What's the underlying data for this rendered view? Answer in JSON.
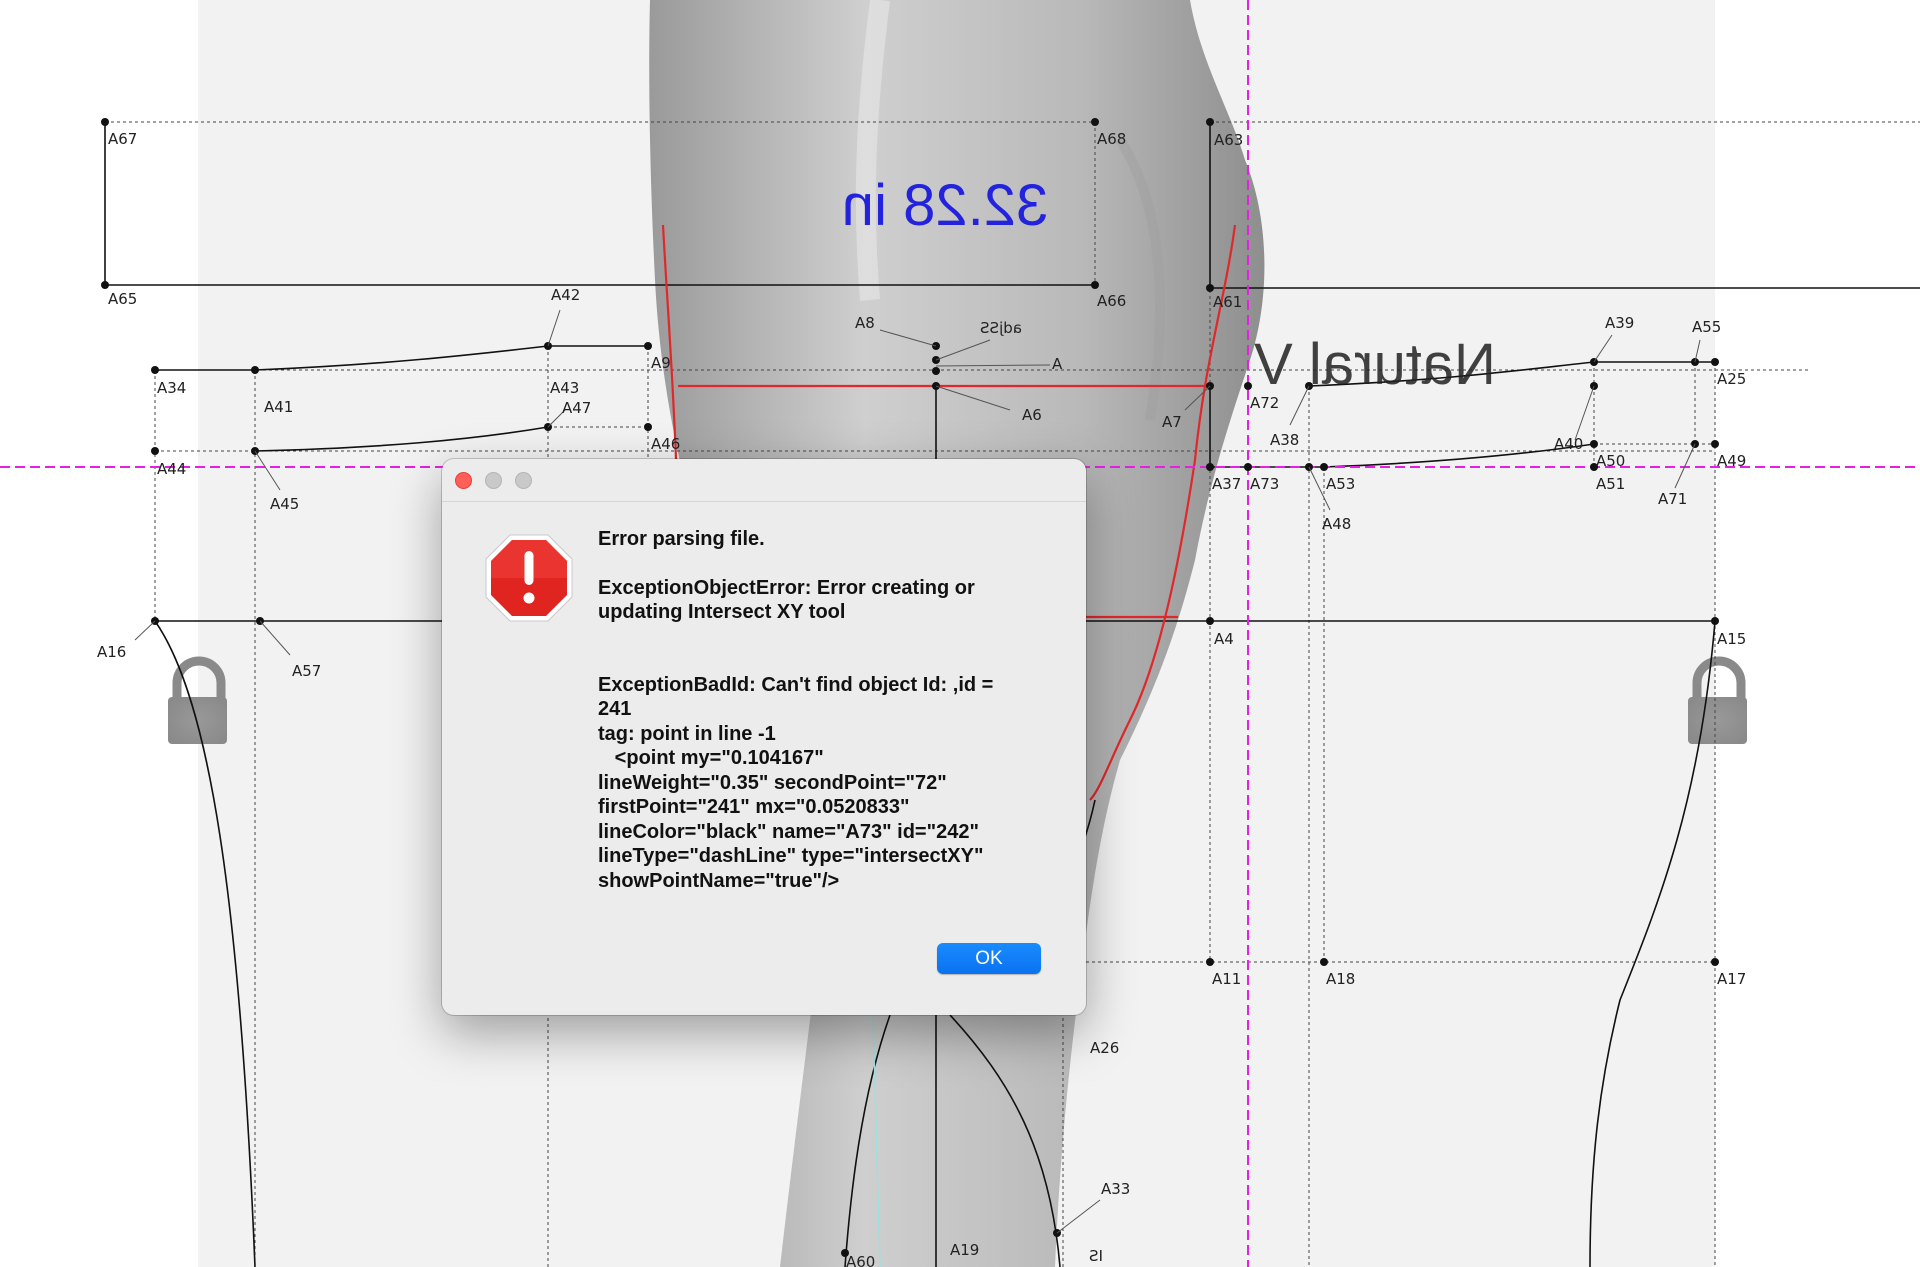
{
  "canvas": {
    "measurement_label": "32.28 in",
    "mirrored_title": "Natural V",
    "point_labels": [
      "A67",
      "A68",
      "A63",
      "A65",
      "A66",
      "A61",
      "A42",
      "A8",
      "adjSS",
      "A39",
      "A55",
      "A9",
      "A",
      "A25",
      "A34",
      "A41",
      "A43",
      "A47",
      "A6",
      "A7",
      "A72",
      "A38",
      "A40",
      "A50",
      "A46",
      "A44",
      "A45",
      "A37",
      "A73",
      "A53",
      "A51",
      "A71",
      "A49",
      "A48",
      "A16",
      "A57",
      "A4",
      "A15",
      "A11",
      "A18",
      "A17",
      "A26",
      "A33",
      "A19",
      "A60",
      "IS"
    ],
    "colors": {
      "guide": "#e51fe5",
      "red_line": "#e0282a",
      "measurement": "#2323dd"
    }
  },
  "dialog": {
    "icon": "stop-alert-icon",
    "line1": "Error parsing file.",
    "line2": "ExceptionObjectError: Error creating or\nupdating Intersect XY tool",
    "line3": "ExceptionBadId: Can't find object Id: ,id =\n241\ntag: point in line -1\n   <point my=\"0.104167\"\nlineWeight=\"0.35\" secondPoint=\"72\"\nfirstPoint=\"241\" mx=\"0.0520833\"\nlineColor=\"black\" name=\"A73\" id=\"242\"\nlineType=\"dashLine\" type=\"intersectXY\"\nshowPointName=\"true\"/>",
    "ok_label": "OK"
  }
}
